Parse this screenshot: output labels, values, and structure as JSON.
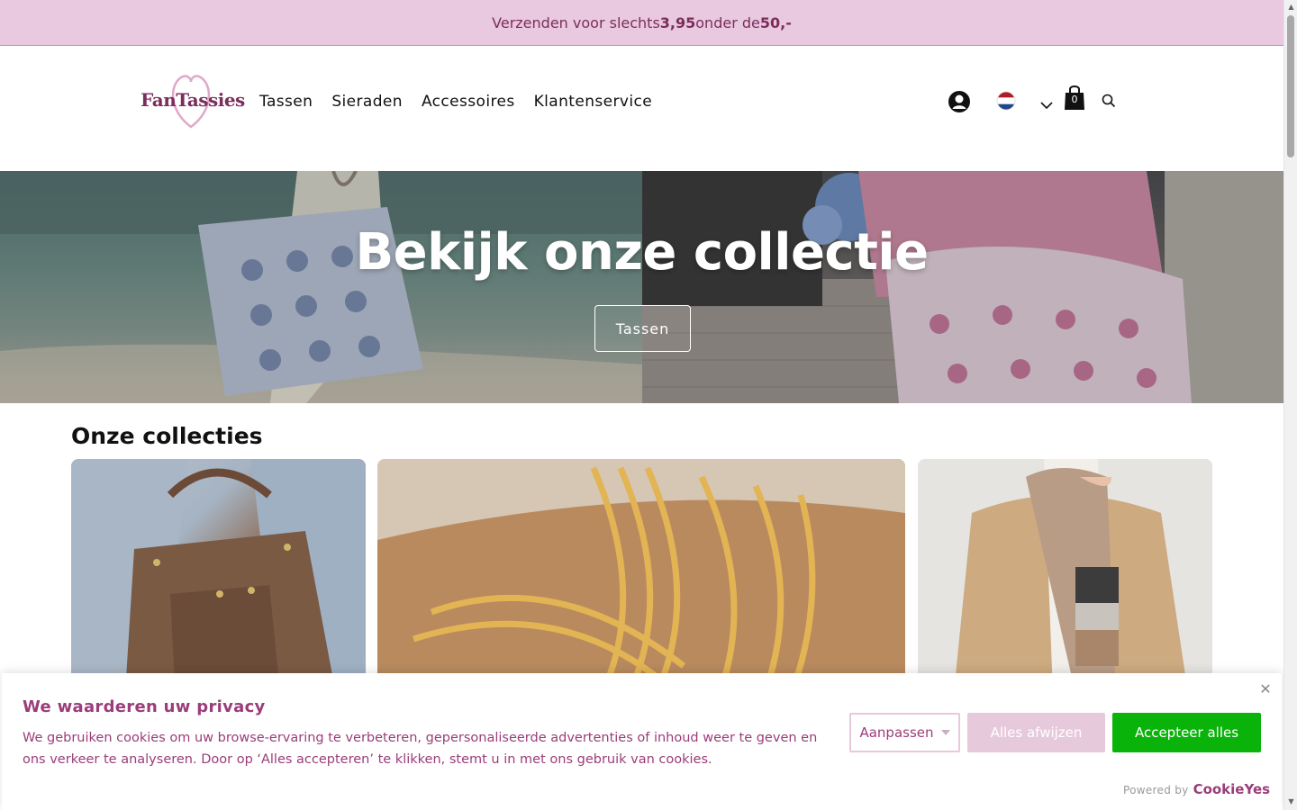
{
  "announcement": {
    "prefix": "Verzenden voor slechts ",
    "price": "3,95",
    "middle": " onder de ",
    "threshold": "50,-"
  },
  "header": {
    "logo_text": "FanTassies",
    "nav": [
      "Tassen",
      "Sieraden",
      "Accessoires",
      "Klantenservice"
    ],
    "cart_count": "0",
    "icons": [
      "account-icon",
      "netherlands-flag-icon",
      "chevron-down-icon",
      "cart-icon",
      "search-icon"
    ]
  },
  "hero": {
    "title": "Bekijk onze collectie",
    "button_label": "Tassen"
  },
  "collections": {
    "title": "Onze collecties"
  },
  "cookie_banner": {
    "title": "We waarderen uw privacy",
    "text": "We gebruiken cookies om uw browse-ervaring te verbeteren, gepersonaliseerde advertenties of inhoud weer te geven en ons verkeer te analyseren. Door op ‘Alles accepteren’ te klikken, stemt u in met ons gebruik van cookies.",
    "customize_label": "Aanpassen",
    "reject_label": "Alles afwijzen",
    "accept_label": "Accepteer alles",
    "powered_by": "Powered by",
    "powered_brand": "CookieYes"
  },
  "colors": {
    "announcement_bg": "#e9c9df",
    "brand_plum": "#9a3d79",
    "accept_green": "#0ab30a",
    "reject_pink": "#e7c9dc"
  }
}
